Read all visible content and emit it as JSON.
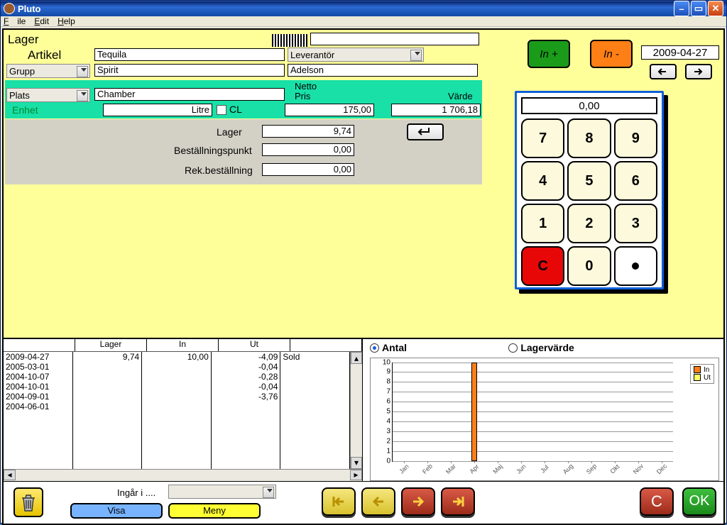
{
  "window": {
    "title": "Pluto"
  },
  "menubar": {
    "file": "File",
    "edit": "Edit",
    "help": "Help"
  },
  "header": {
    "lager": "Lager"
  },
  "form": {
    "artikel_label": "Artikel",
    "artikel": "Tequila",
    "leverantor_label": "Leverantör",
    "grupp_label": "Grupp",
    "grupp": "Spirit",
    "leverantor": "Adelson",
    "plats_label": "Plats",
    "plats": "Chamber",
    "netto_label": "Netto",
    "pris_label": "Pris",
    "varde_label": "Värde",
    "enhet_label": "Enhet",
    "enhet": "Litre",
    "cl_label": "CL",
    "pris": "175,00",
    "varde": "1 706,18",
    "lager_label": "Lager",
    "lager": "9,74",
    "bestpkt_label": "Beställningspunkt",
    "bestpkt": "0,00",
    "rekbest_label": "Rek.beställning",
    "rekbest": "0,00"
  },
  "side": {
    "in_plus": "In +",
    "in_minus": "In -",
    "date": "2009-04-27",
    "keypad_display": "0,00",
    "keys": [
      "7",
      "8",
      "9",
      "4",
      "5",
      "6",
      "1",
      "2",
      "3",
      "C",
      "0",
      "."
    ]
  },
  "table": {
    "headers": [
      "",
      "Lager",
      "In",
      "Ut",
      ""
    ],
    "rows": [
      {
        "date": "2009-04-27",
        "lager": "9,74",
        "in": "10,00",
        "ut": "",
        "note": ""
      },
      {
        "date": "2005-03-01",
        "lager": "",
        "in": "",
        "ut": "-4,09",
        "note": ""
      },
      {
        "date": "2004-10-07",
        "lager": "",
        "in": "",
        "ut": "-0,04",
        "note": "Sold"
      },
      {
        "date": "2004-10-01",
        "lager": "",
        "in": "",
        "ut": "-0,28",
        "note": ""
      },
      {
        "date": "2004-09-01",
        "lager": "",
        "in": "",
        "ut": "-0,04",
        "note": ""
      },
      {
        "date": "2004-06-01",
        "lager": "",
        "in": "",
        "ut": "-3,76",
        "note": ""
      }
    ]
  },
  "chart_header": {
    "antal": "Antal",
    "lagervarde": "Lagervärde"
  },
  "chart_data": {
    "type": "bar",
    "title": "",
    "xlabel": "",
    "ylabel": "",
    "ylim": [
      0,
      10
    ],
    "categories": [
      "Jan",
      "Feb",
      "Mar",
      "Apr",
      "Maj",
      "Jun",
      "Jul",
      "Aug",
      "Sep",
      "Okt",
      "Nov",
      "Dec"
    ],
    "series": [
      {
        "name": "In",
        "color": "#ff7f17",
        "values": [
          0,
          0,
          0,
          10,
          0,
          0,
          0,
          0,
          0,
          0,
          0,
          0
        ]
      },
      {
        "name": "Ut",
        "color": "#ffff66",
        "values": [
          0,
          0,
          0,
          0,
          0,
          0,
          0,
          0,
          0,
          0,
          0,
          0
        ]
      }
    ]
  },
  "footer": {
    "ingar_label": "Ingår i ....",
    "visa": "Visa",
    "meny": "Meny",
    "c": "C",
    "ok": "OK"
  }
}
